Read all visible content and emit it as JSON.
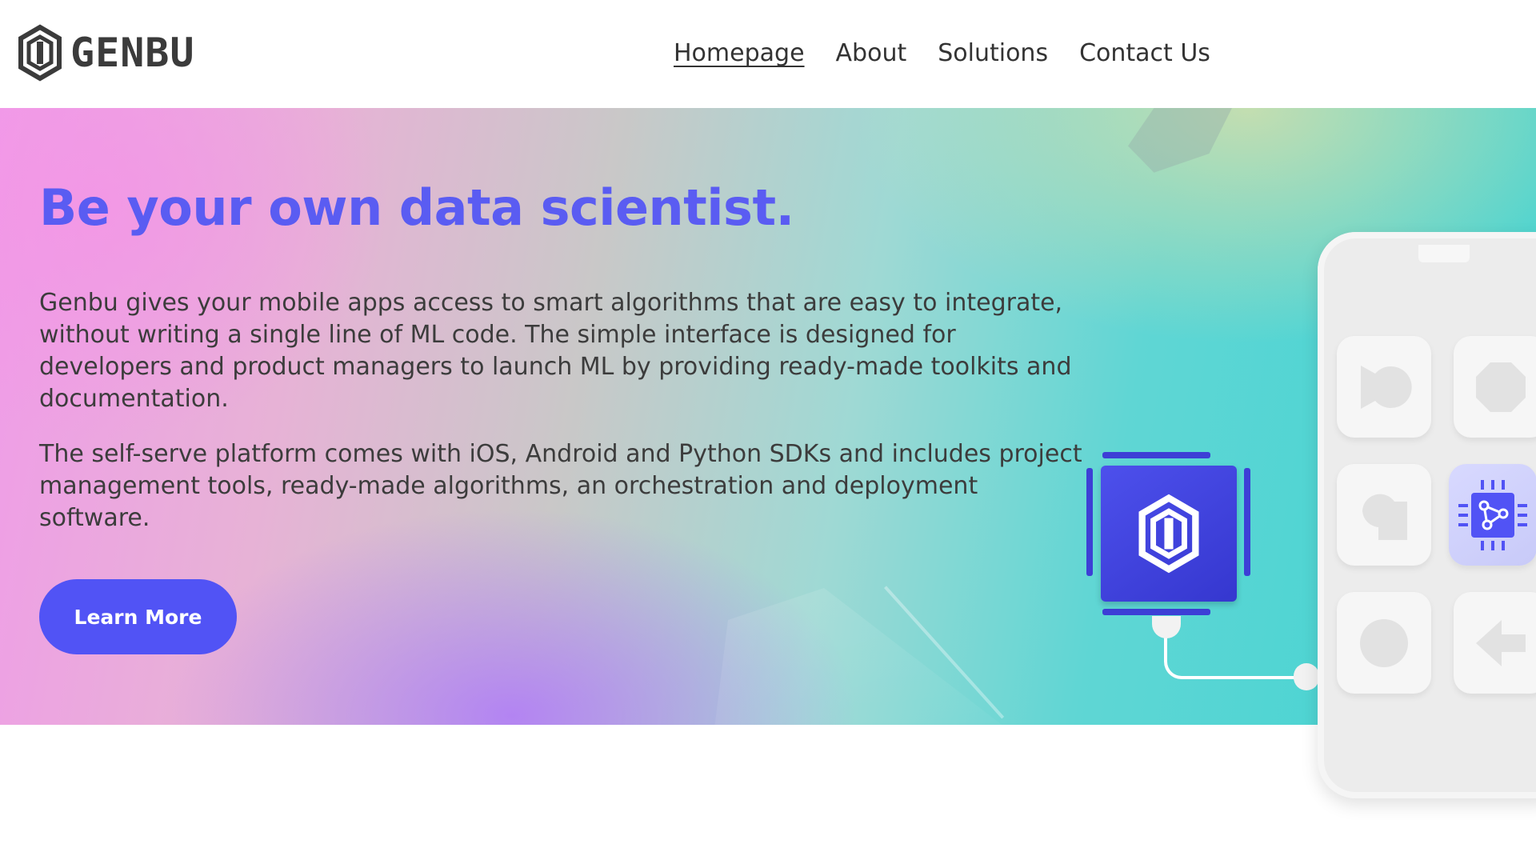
{
  "header": {
    "logo_text": "GENBU",
    "nav": [
      {
        "label": "Homepage",
        "active": true
      },
      {
        "label": "About",
        "active": false
      },
      {
        "label": "Solutions",
        "active": false
      },
      {
        "label": "Contact Us",
        "active": false
      }
    ]
  },
  "hero": {
    "title": "Be your own data scientist.",
    "paragraph_1": "Genbu gives your mobile apps access to smart algorithms that are easy to integrate, without writing a single line of ML code. The simple interface is designed for developers and product managers to launch ML by providing ready-made toolkits and documentation.",
    "paragraph_2": "The self-serve platform comes with iOS, Android and Python SDKs and includes project management tools, ready-made algorithms, an orchestration and deployment software.",
    "cta_label": "Learn More"
  },
  "illustration": {
    "chip_icon": "genbu-hexagon-logo-icon",
    "phone_tiles": [
      "speech-bubble-icon",
      "octagon-icon",
      "puzzle-icon",
      "network-chip-icon",
      "circle-icon",
      "arrow-left-icon"
    ]
  },
  "colors": {
    "accent": "#5153f5",
    "title": "#5a5cf2",
    "text": "#3c3c3c"
  }
}
